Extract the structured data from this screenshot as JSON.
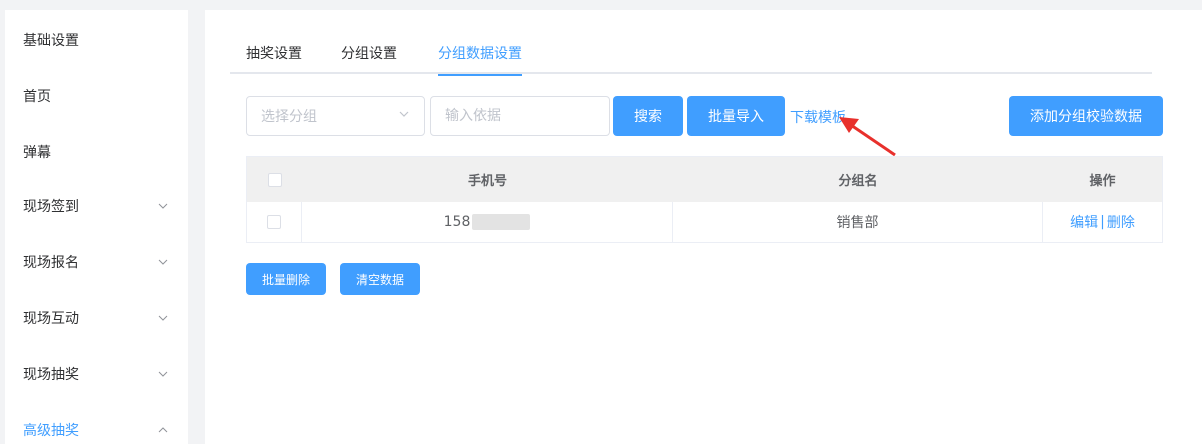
{
  "sidebar": {
    "items": [
      {
        "label": "基础设置",
        "expandable": false
      },
      {
        "label": "首页",
        "expandable": false
      },
      {
        "label": "弹幕",
        "expandable": false
      },
      {
        "label": "现场签到",
        "expandable": true
      },
      {
        "label": "现场报名",
        "expandable": true
      },
      {
        "label": "现场互动",
        "expandable": true
      },
      {
        "label": "现场抽奖",
        "expandable": true
      },
      {
        "label": "高级抽奖",
        "expandable": true,
        "active": true
      }
    ]
  },
  "tabs": [
    {
      "label": "抽奖设置"
    },
    {
      "label": "分组设置"
    },
    {
      "label": "分组数据设置",
      "active": true
    }
  ],
  "toolbar": {
    "group_select_placeholder": "选择分组",
    "basis_input_placeholder": "输入依据",
    "search_label": "搜索",
    "import_label": "批量导入",
    "download_template_label": "下载模板",
    "add_label": "添加分组校验数据"
  },
  "table": {
    "headers": {
      "phone": "手机号",
      "group": "分组名",
      "actions": "操作"
    },
    "rows": [
      {
        "phone": "158",
        "group": "销售部",
        "edit": "编辑",
        "delete": "删除"
      }
    ]
  },
  "bottom": {
    "batch_delete_label": "批量删除",
    "clear_label": "清空数据"
  },
  "colors": {
    "accent": "#409eff",
    "arrow": "#e8302c",
    "header_bg": "#f0f0f0"
  }
}
